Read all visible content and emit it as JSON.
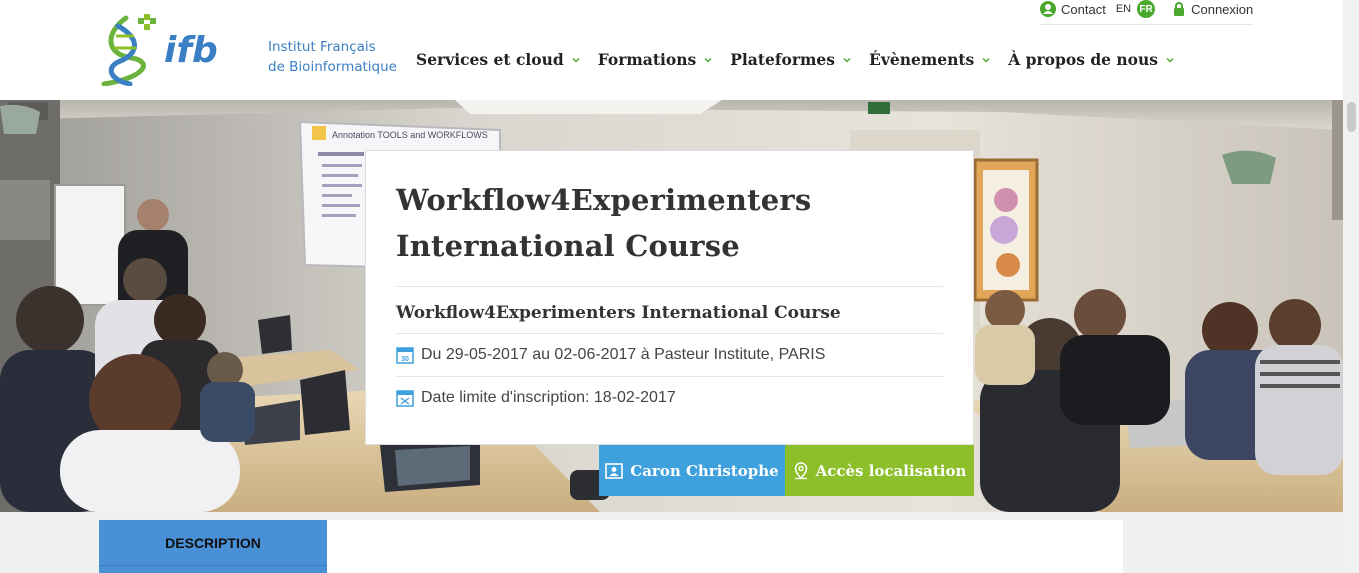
{
  "brand": {
    "line1": "Institut Français",
    "line2": "de Bioinformatique",
    "logo_text": "ifb"
  },
  "nav": [
    {
      "label": "Services et cloud"
    },
    {
      "label": "Formations"
    },
    {
      "label": "Plateformes"
    },
    {
      "label": "Évènements"
    },
    {
      "label": "À propos de nous"
    }
  ],
  "topbar": {
    "contact_label": "Contact",
    "lang_en": "EN",
    "lang_fr": "FR",
    "login_label": "Connexion"
  },
  "event": {
    "title": "Workflow4Experimenters International Course",
    "subtitle": "Workflow4Experimenters International Course",
    "dates": "Du 29-05-2017 au 02-06-2017 à Pasteur Institute, PARIS",
    "deadline": "Date limite d'inscription: 18-02-2017",
    "calendar_day": "30"
  },
  "actions": {
    "contact_person": "Caron Christophe",
    "location": "Accès localisation"
  },
  "tabs": {
    "description": "DESCRIPTION"
  },
  "slide_text": "Annotation TOOLS and WORKFLOWS",
  "colors": {
    "brand_blue": "#3a7fc4",
    "green": "#8cbf2a",
    "blue_button": "#3ea0dc",
    "tab_blue": "#4a90d6"
  }
}
